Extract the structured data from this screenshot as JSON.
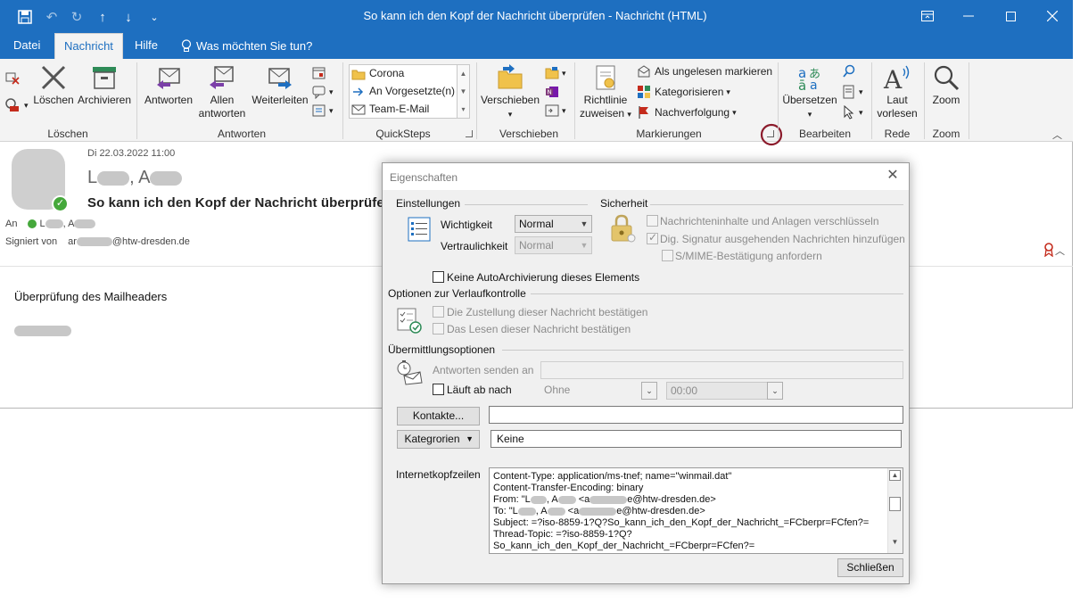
{
  "window": {
    "title": "So kann ich den Kopf der Nachricht überprüfen  -  Nachricht (HTML)"
  },
  "tabs": [
    {
      "label": "Datei"
    },
    {
      "label": "Nachricht"
    },
    {
      "label": "Hilfe"
    },
    {
      "label": "Was möchten Sie tun?"
    }
  ],
  "ribbon": {
    "loeschen_group": {
      "label": "Löschen",
      "delete": "Löschen",
      "archive": "Archivieren"
    },
    "antworten_group": {
      "label": "Antworten",
      "reply": "Antworten",
      "reply_all_1": "Allen",
      "reply_all_2": "antworten",
      "forward": "Weiterleiten"
    },
    "quicksteps_group": {
      "label": "QuickSteps",
      "items": [
        "Corona",
        "An Vorgesetzte(n)",
        "Team-E-Mail"
      ]
    },
    "verschieben_group": {
      "label": "Verschieben",
      "move": "Verschieben"
    },
    "markierungen_group": {
      "label": "Markierungen",
      "rules_1": "Richtlinie",
      "rules_2": "zuweisen",
      "mark_unread": "Als ungelesen markieren",
      "categorize": "Kategorisieren",
      "follow_up": "Nachverfolgung"
    },
    "bearbeiten_group": {
      "label": "Bearbeiten",
      "translate": "Übersetzen"
    },
    "rede_group": {
      "label": "Rede",
      "read_aloud_1": "Laut",
      "read_aloud_2": "vorlesen"
    },
    "zoom_group": {
      "label": "Zoom",
      "zoom": "Zoom"
    }
  },
  "message": {
    "date": "Di 22.03.2022 11:00",
    "sender_prefix": "L",
    "sender_mid": ", A",
    "subject": "So kann ich den Kopf der Nachricht überprüfen",
    "to_label": "An",
    "to_prefix": "L",
    "to_mid": ", A",
    "signed_label": "Signiert von",
    "signed_prefix": "ar",
    "signed_domain": "@htw-dresden.de",
    "body": "Überprüfung des Mailheaders"
  },
  "dialog": {
    "title": "Eigenschaften",
    "settings": {
      "title": "Einstellungen",
      "importance_label": "Wichtigkeit",
      "importance_value": "Normal",
      "sensitivity_label": "Vertraulichkeit",
      "sensitivity_value": "Normal"
    },
    "security": {
      "title": "Sicherheit",
      "encrypt": "Nachrichteninhalte und Anlagen verschlüsseln",
      "sign": "Dig. Signatur ausgehenden Nachrichten hinzufügen",
      "smime": "S/MIME-Bestätigung anfordern"
    },
    "no_autoarchive": "Keine AutoArchivierung dieses Elements",
    "tracking": {
      "title": "Optionen zur Verlaufkontrolle",
      "delivery": "Die Zustellung dieser Nachricht bestätigen",
      "read": "Das Lesen dieser Nachricht bestätigen"
    },
    "delivery": {
      "title": "Übermittlungsoptionen",
      "reply_to": "Antworten senden an",
      "expires": "Läuft ab nach",
      "expires_date": "Ohne",
      "expires_time": "00:00"
    },
    "contacts_button": "Kontakte...",
    "categories_button": "Kategrorien",
    "categories_value": "Keine",
    "headers_label": "Internetkopfzeilen",
    "headers": {
      "l1": "Content-Type: application/ms-tnef; name=\"winmail.dat\"",
      "l2": "Content-Transfer-Encoding: binary",
      "l3_a": "From: \"L",
      "l3_b": ", A",
      "l3_c": " <a",
      "l3_d": "e@htw-dresden.de>",
      "l4_a": "To: \"L",
      "l4_b": ", A",
      "l4_c": " <a",
      "l4_d": "e@htw-dresden.de>",
      "l5": "Subject: =?iso-8859-1?Q?So_kann_ich_den_Kopf_der_Nachricht_=FCberpr=FCfen?=",
      "l6": "Thread-Topic: =?iso-8859-1?Q?",
      "l7": "So_kann_ich_den_Kopf_der_Nachricht_=FCberpr=FCfen?="
    },
    "close_button": "Schließen"
  },
  "colors": {
    "titlebar": "#1e6fc0",
    "ribbon_bg": "#f3f3f3",
    "dialog_bg": "#f0f0f0",
    "annotation_circle": "#8b1a2b"
  }
}
